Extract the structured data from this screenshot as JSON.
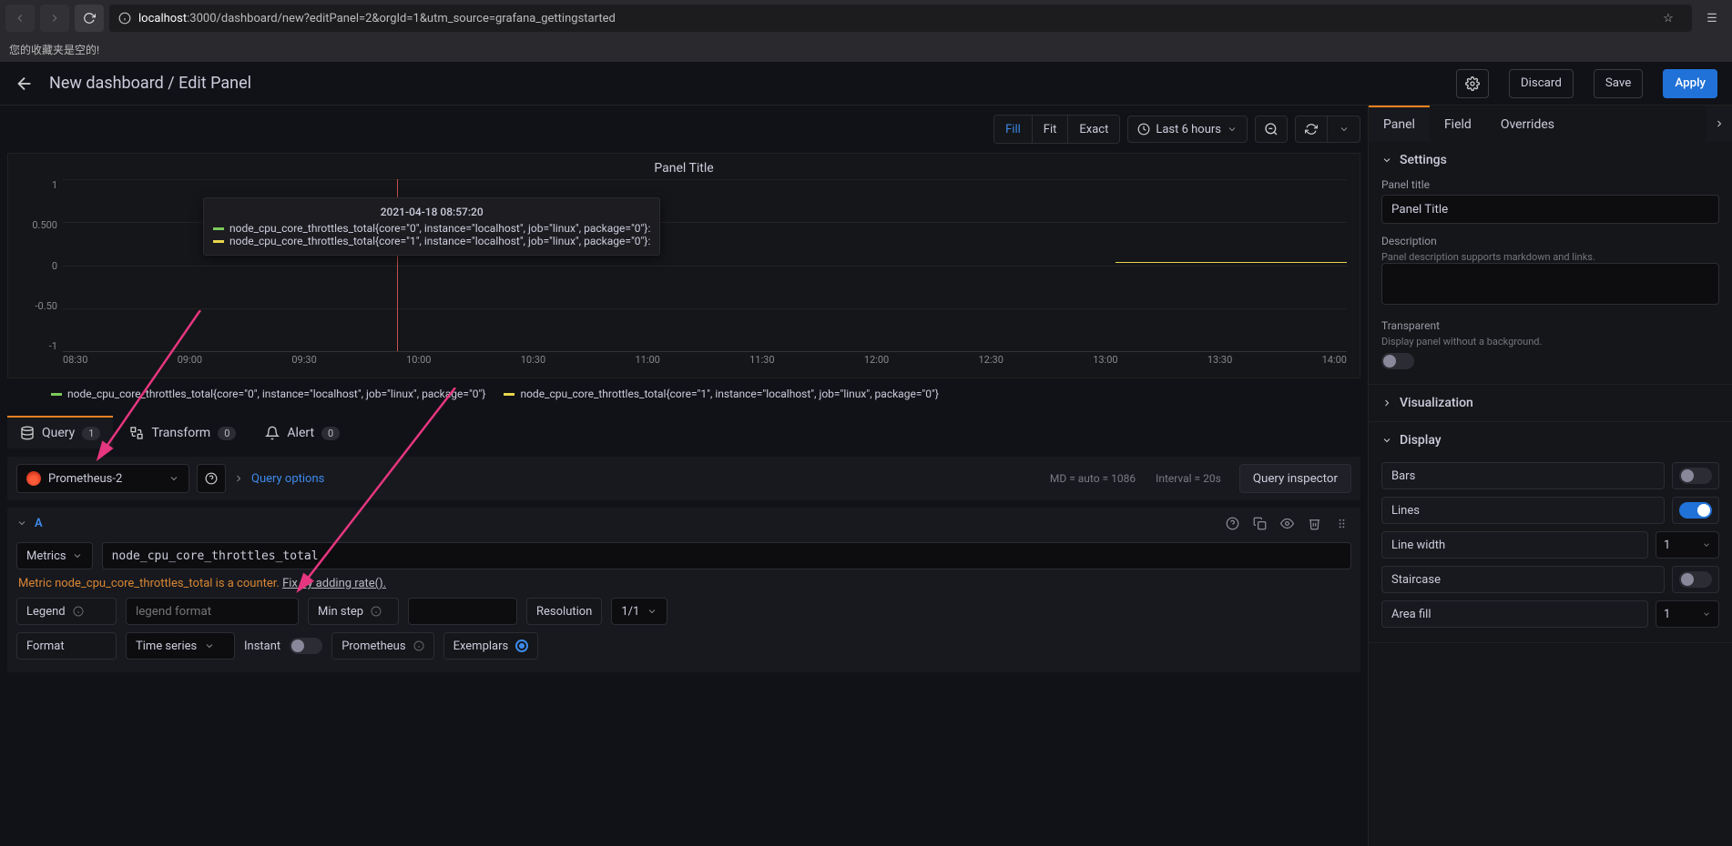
{
  "browser": {
    "url_host": "localhost",
    "url_rest": ":3000/dashboard/new?editPanel=2&orgId=1&utm_source=grafana_gettingstarted",
    "bookmarks_empty": "您的收藏夹是空的!"
  },
  "header": {
    "breadcrumb": "New dashboard / Edit Panel",
    "discard": "Discard",
    "save": "Save",
    "apply": "Apply"
  },
  "chart_toolbar": {
    "fill": "Fill",
    "fit": "Fit",
    "exact": "Exact",
    "time_range": "Last 6 hours"
  },
  "panel": {
    "title": "Panel Title",
    "tooltip_time": "2021-04-18 08:57:20",
    "tooltip_s1": "node_cpu_core_throttles_total{core=\"0\", instance=\"localhost\", job=\"linux\", package=\"0\"}:",
    "tooltip_s2": "node_cpu_core_throttles_total{core=\"1\", instance=\"localhost\", job=\"linux\", package=\"0\"}:",
    "y_ticks": [
      "1",
      "0.500",
      "0",
      "-0.50",
      "-1"
    ],
    "x_ticks": [
      "08:30",
      "09:00",
      "09:30",
      "10:00",
      "10:30",
      "11:00",
      "11:30",
      "12:00",
      "12:30",
      "13:00",
      "13:30",
      "14:00"
    ],
    "legend_a": "node_cpu_core_throttles_total{core=\"0\", instance=\"localhost\", job=\"linux\", package=\"0\"}",
    "legend_b": "node_cpu_core_throttles_total{core=\"1\", instance=\"localhost\", job=\"linux\", package=\"0\"}"
  },
  "chart_data": {
    "type": "line",
    "title": "Panel Title",
    "xlabel": "",
    "ylabel": "",
    "ylim": [
      -1,
      1
    ],
    "x_range": [
      "08:30",
      "14:00"
    ],
    "series": [
      {
        "name": "node_cpu_core_throttles_total{core=\"0\", instance=\"localhost\", job=\"linux\", package=\"0\"}",
        "color": "#7bcb5c",
        "approximate_value": 0
      },
      {
        "name": "node_cpu_core_throttles_total{core=\"1\", instance=\"localhost\", job=\"linux\", package=\"0\"}",
        "color": "#e8d44c",
        "approximate_value": 0,
        "segments": [
          {
            "from": "13:00",
            "to": "14:00",
            "value": 0
          }
        ]
      }
    ]
  },
  "qtabs": {
    "query": "Query",
    "query_count": "1",
    "transform": "Transform",
    "transform_count": "0",
    "alert": "Alert",
    "alert_count": "0"
  },
  "query": {
    "datasource": "Prometheus-2",
    "query_options": "Query options",
    "meta_md": "MD = auto = 1086",
    "meta_interval": "Interval = 20s",
    "inspector": "Query inspector",
    "letter": "A",
    "metrics_label": "Metrics",
    "metric_value": "node_cpu_core_throttles_total",
    "hint_text": "Metric node_cpu_core_throttles_total is a counter.",
    "hint_link": "Fix by adding rate().",
    "legend_label": "Legend",
    "legend_placeholder": "legend format",
    "minstep_label": "Min step",
    "resolution_label": "Resolution",
    "resolution_value": "1/1",
    "format_label": "Format",
    "format_value": "Time series",
    "instant_label": "Instant",
    "prometheus_label": "Prometheus",
    "exemplars_label": "Exemplars"
  },
  "sidebar": {
    "tabs": {
      "panel": "Panel",
      "field": "Field",
      "overrides": "Overrides"
    },
    "settings": {
      "title": "Settings",
      "panel_title_label": "Panel title",
      "panel_title_value": "Panel Title",
      "description_label": "Description",
      "description_sub": "Panel description supports markdown and links.",
      "transparent_label": "Transparent",
      "transparent_sub": "Display panel without a background."
    },
    "visualization": "Visualization",
    "display": {
      "title": "Display",
      "bars": "Bars",
      "lines": "Lines",
      "linewidth": "Line width",
      "linewidth_val": "1",
      "staircase": "Staircase",
      "areafill": "Area fill",
      "areafill_val": "1"
    }
  }
}
